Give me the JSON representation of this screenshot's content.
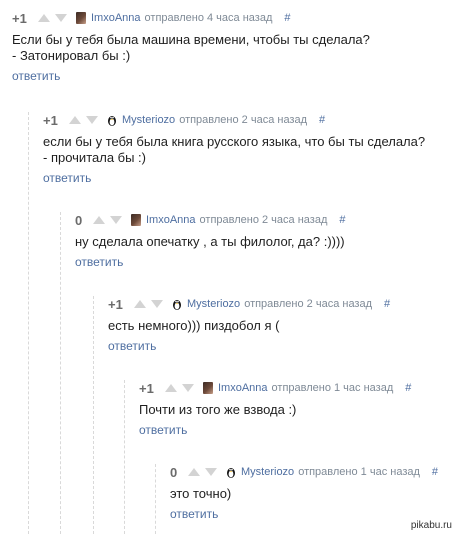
{
  "reply_label": "ответить",
  "comments": [
    {
      "rating": "+1",
      "author": "ImxoAnna",
      "meta": "отправлено 4 часа назад",
      "hash": "#",
      "avatar": "photo",
      "text": "Если бы у тебя была машина времени, чтобы ты сделала?\n- Затонировал бы :)"
    },
    {
      "rating": "+1",
      "author": "Mysteriozo",
      "meta": "отправлено 2 часа назад",
      "hash": "#",
      "avatar": "penguin-icon",
      "text": "если бы у тебя была книга русского языка, что бы ты сделала?\n- прочитала бы :)"
    },
    {
      "rating": "0",
      "author": "ImxoAnna",
      "meta": "отправлено 2 часа назад",
      "hash": "#",
      "avatar": "photo",
      "text": "ну сделала опечатку , а ты филолог, да? :))))"
    },
    {
      "rating": "+1",
      "author": "Mysteriozo",
      "meta": "отправлено 2 часа назад",
      "hash": "#",
      "avatar": "penguin-icon",
      "text": "есть немного))) пиздобол я ("
    },
    {
      "rating": "+1",
      "author": "ImxoAnna",
      "meta": "отправлено 1 час назад",
      "hash": "#",
      "avatar": "photo",
      "text": "Почти из того же взвода :)"
    },
    {
      "rating": "0",
      "author": "Mysteriozo",
      "meta": "отправлено 1 час назад",
      "hash": "#",
      "avatar": "penguin-icon",
      "text": "это точно)"
    }
  ],
  "watermark": "pikabu.ru"
}
